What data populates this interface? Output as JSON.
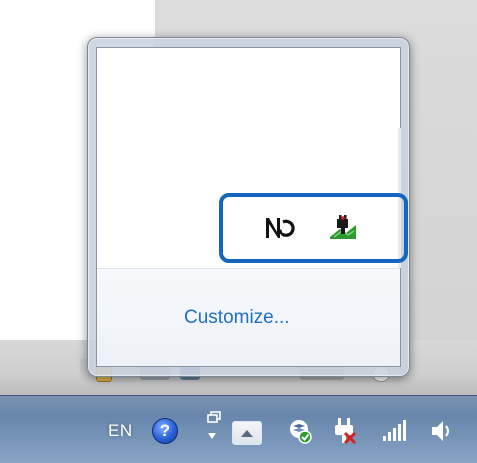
{
  "popup": {
    "customize_label": "Customize...",
    "hidden_icons": [
      {
        "name": "sync-icon"
      },
      {
        "name": "network-plug-icon"
      }
    ]
  },
  "taskbar": {
    "language": "EN",
    "help_glyph": "?",
    "tray_icons": [
      {
        "name": "action-center-flag-icon"
      },
      {
        "name": "power-plug-icon"
      },
      {
        "name": "signal-strength-icon"
      },
      {
        "name": "volume-icon"
      }
    ]
  },
  "colors": {
    "link": "#1e6fc4",
    "highlight": "#1565c0",
    "taskbar": "#6b89ae"
  }
}
